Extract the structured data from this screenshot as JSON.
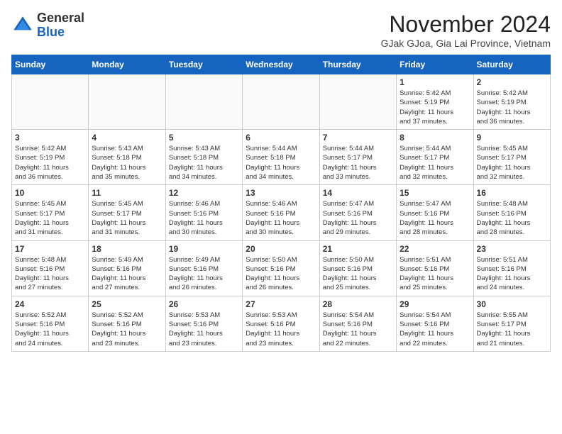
{
  "header": {
    "logo_general": "General",
    "logo_blue": "Blue",
    "month_year": "November 2024",
    "location": "GJak GJoa, Gia Lai Province, Vietnam"
  },
  "weekdays": [
    "Sunday",
    "Monday",
    "Tuesday",
    "Wednesday",
    "Thursday",
    "Friday",
    "Saturday"
  ],
  "weeks": [
    [
      {
        "day": "",
        "info": ""
      },
      {
        "day": "",
        "info": ""
      },
      {
        "day": "",
        "info": ""
      },
      {
        "day": "",
        "info": ""
      },
      {
        "day": "",
        "info": ""
      },
      {
        "day": "1",
        "info": "Sunrise: 5:42 AM\nSunset: 5:19 PM\nDaylight: 11 hours\nand 37 minutes."
      },
      {
        "day": "2",
        "info": "Sunrise: 5:42 AM\nSunset: 5:19 PM\nDaylight: 11 hours\nand 36 minutes."
      }
    ],
    [
      {
        "day": "3",
        "info": "Sunrise: 5:42 AM\nSunset: 5:19 PM\nDaylight: 11 hours\nand 36 minutes."
      },
      {
        "day": "4",
        "info": "Sunrise: 5:43 AM\nSunset: 5:18 PM\nDaylight: 11 hours\nand 35 minutes."
      },
      {
        "day": "5",
        "info": "Sunrise: 5:43 AM\nSunset: 5:18 PM\nDaylight: 11 hours\nand 34 minutes."
      },
      {
        "day": "6",
        "info": "Sunrise: 5:44 AM\nSunset: 5:18 PM\nDaylight: 11 hours\nand 34 minutes."
      },
      {
        "day": "7",
        "info": "Sunrise: 5:44 AM\nSunset: 5:17 PM\nDaylight: 11 hours\nand 33 minutes."
      },
      {
        "day": "8",
        "info": "Sunrise: 5:44 AM\nSunset: 5:17 PM\nDaylight: 11 hours\nand 32 minutes."
      },
      {
        "day": "9",
        "info": "Sunrise: 5:45 AM\nSunset: 5:17 PM\nDaylight: 11 hours\nand 32 minutes."
      }
    ],
    [
      {
        "day": "10",
        "info": "Sunrise: 5:45 AM\nSunset: 5:17 PM\nDaylight: 11 hours\nand 31 minutes."
      },
      {
        "day": "11",
        "info": "Sunrise: 5:45 AM\nSunset: 5:17 PM\nDaylight: 11 hours\nand 31 minutes."
      },
      {
        "day": "12",
        "info": "Sunrise: 5:46 AM\nSunset: 5:16 PM\nDaylight: 11 hours\nand 30 minutes."
      },
      {
        "day": "13",
        "info": "Sunrise: 5:46 AM\nSunset: 5:16 PM\nDaylight: 11 hours\nand 30 minutes."
      },
      {
        "day": "14",
        "info": "Sunrise: 5:47 AM\nSunset: 5:16 PM\nDaylight: 11 hours\nand 29 minutes."
      },
      {
        "day": "15",
        "info": "Sunrise: 5:47 AM\nSunset: 5:16 PM\nDaylight: 11 hours\nand 28 minutes."
      },
      {
        "day": "16",
        "info": "Sunrise: 5:48 AM\nSunset: 5:16 PM\nDaylight: 11 hours\nand 28 minutes."
      }
    ],
    [
      {
        "day": "17",
        "info": "Sunrise: 5:48 AM\nSunset: 5:16 PM\nDaylight: 11 hours\nand 27 minutes."
      },
      {
        "day": "18",
        "info": "Sunrise: 5:49 AM\nSunset: 5:16 PM\nDaylight: 11 hours\nand 27 minutes."
      },
      {
        "day": "19",
        "info": "Sunrise: 5:49 AM\nSunset: 5:16 PM\nDaylight: 11 hours\nand 26 minutes."
      },
      {
        "day": "20",
        "info": "Sunrise: 5:50 AM\nSunset: 5:16 PM\nDaylight: 11 hours\nand 26 minutes."
      },
      {
        "day": "21",
        "info": "Sunrise: 5:50 AM\nSunset: 5:16 PM\nDaylight: 11 hours\nand 25 minutes."
      },
      {
        "day": "22",
        "info": "Sunrise: 5:51 AM\nSunset: 5:16 PM\nDaylight: 11 hours\nand 25 minutes."
      },
      {
        "day": "23",
        "info": "Sunrise: 5:51 AM\nSunset: 5:16 PM\nDaylight: 11 hours\nand 24 minutes."
      }
    ],
    [
      {
        "day": "24",
        "info": "Sunrise: 5:52 AM\nSunset: 5:16 PM\nDaylight: 11 hours\nand 24 minutes."
      },
      {
        "day": "25",
        "info": "Sunrise: 5:52 AM\nSunset: 5:16 PM\nDaylight: 11 hours\nand 23 minutes."
      },
      {
        "day": "26",
        "info": "Sunrise: 5:53 AM\nSunset: 5:16 PM\nDaylight: 11 hours\nand 23 minutes."
      },
      {
        "day": "27",
        "info": "Sunrise: 5:53 AM\nSunset: 5:16 PM\nDaylight: 11 hours\nand 23 minutes."
      },
      {
        "day": "28",
        "info": "Sunrise: 5:54 AM\nSunset: 5:16 PM\nDaylight: 11 hours\nand 22 minutes."
      },
      {
        "day": "29",
        "info": "Sunrise: 5:54 AM\nSunset: 5:16 PM\nDaylight: 11 hours\nand 22 minutes."
      },
      {
        "day": "30",
        "info": "Sunrise: 5:55 AM\nSunset: 5:17 PM\nDaylight: 11 hours\nand 21 minutes."
      }
    ]
  ]
}
